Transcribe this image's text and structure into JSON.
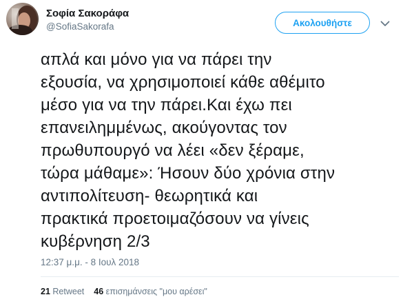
{
  "author": {
    "display_name": "Σοφία Σακοράφα",
    "screen_name": "@SofiaSakorafa",
    "avatar_icon": "profile-photo"
  },
  "follow_button": {
    "label": "Ακολουθήστε"
  },
  "menu_icon": "chevron-down-icon",
  "tweet": {
    "lines": [
      "απλά και μόνο για να πάρει την",
      "εξουσία, να χρησιμοποιεί κάθε αθέμιτο",
      "μέσο για να την πάρει.Και έχω πει",
      "επανειλημμένως, ακούγοντας τον",
      "πρωθυπουργό να λέει «δεν ξέραμε,",
      "τώρα μάθαμε»: Ήσουν δύο χρόνια στην",
      "αντιπολίτευση- θεωρητικά και",
      "πρακτικά προετοιμαζόσουν να γίνεις",
      "κυβέρνηση 2/3"
    ],
    "timestamp": "12:37 μ.μ. - 8 Ιουλ 2018"
  },
  "stats": {
    "retweets_count": "21",
    "retweets_label": "Retweet",
    "likes_count": "46",
    "likes_label": "επισημάνσεις \"μου αρέσει\""
  },
  "colors": {
    "accent": "#1da1f2",
    "text": "#14171a",
    "secondary": "#657786",
    "divider": "#e6ecf0"
  }
}
